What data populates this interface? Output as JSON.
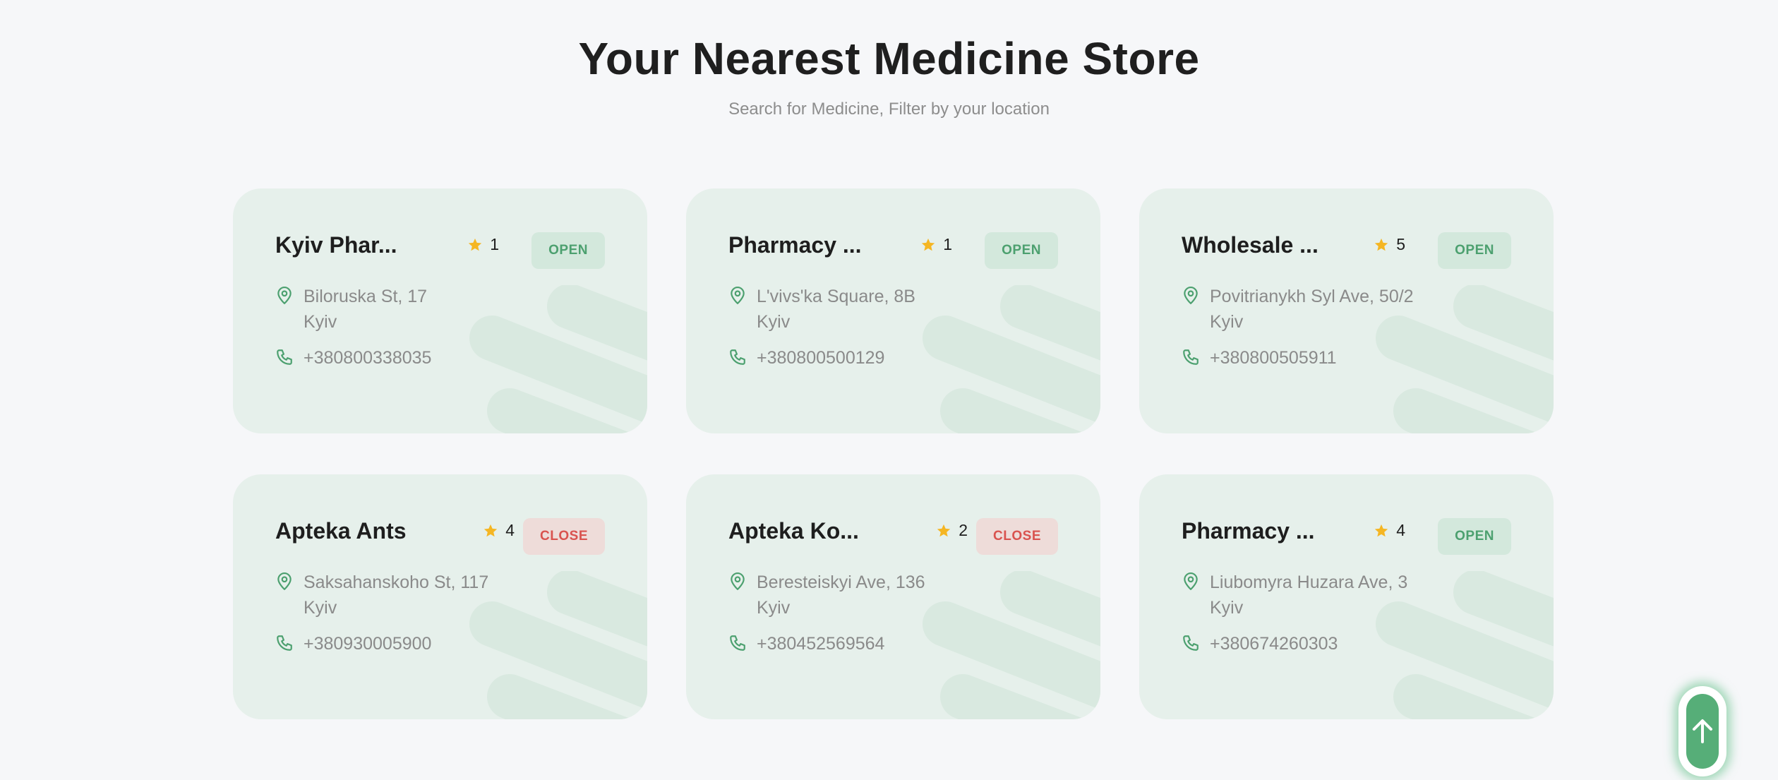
{
  "header": {
    "title": "Your Nearest Medicine Store",
    "subtitle": "Search for Medicine, Filter by your location"
  },
  "colors": {
    "accent_green": "#56ae78",
    "card_bg": "#e6f0eb",
    "open_text": "#4ca06f",
    "close_text": "#d9534f",
    "star": "#f5b623"
  },
  "stores": [
    {
      "name": "Kyiv Phar...",
      "rating": "1",
      "status": "OPEN",
      "address_line1": "Biloruska St, 17",
      "address_line2": "Kyiv",
      "phone": "+380800338035"
    },
    {
      "name": "Pharmacy ...",
      "rating": "1",
      "status": "OPEN",
      "address_line1": "L'vivs'ka Square, 8B",
      "address_line2": "Kyiv",
      "phone": "+380800500129"
    },
    {
      "name": "Wholesale ...",
      "rating": "5",
      "status": "OPEN",
      "address_line1": "Povitrianykh Syl Ave, 50/2",
      "address_line2": "Kyiv",
      "phone": "+380800505911"
    },
    {
      "name": "Apteka Ants",
      "rating": "4",
      "status": "CLOSE",
      "address_line1": "Saksahanskoho St, 117",
      "address_line2": "Kyiv",
      "phone": "+380930005900"
    },
    {
      "name": "Apteka Ko...",
      "rating": "2",
      "status": "CLOSE",
      "address_line1": "Beresteiskyi Ave, 136",
      "address_line2": "Kyiv",
      "phone": "+380452569564"
    },
    {
      "name": "Pharmacy ...",
      "rating": "4",
      "status": "OPEN",
      "address_line1": "Liubomyra Huzara Ave, 3",
      "address_line2": "Kyiv",
      "phone": "+380674260303"
    }
  ],
  "icons": {
    "rating": "star-icon",
    "address": "location-pin-icon",
    "phone": "phone-icon",
    "scroll_top": "arrow-up-icon"
  }
}
